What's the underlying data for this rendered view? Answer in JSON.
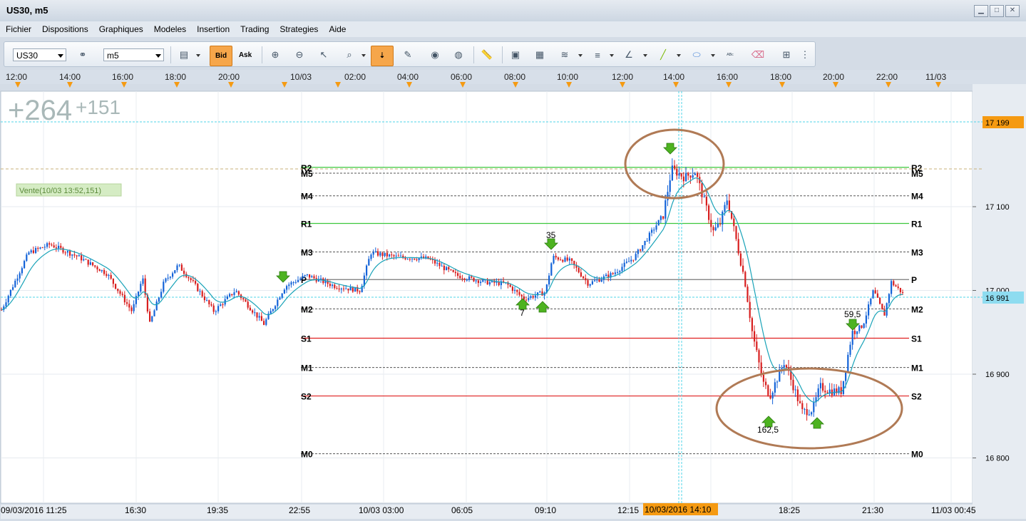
{
  "window": {
    "title": "US30, m5",
    "minimize": "▁",
    "maximize": "□",
    "close": "✕"
  },
  "menu": [
    "Fichier",
    "Dispositions",
    "Graphiques",
    "Modeles",
    "Insertion",
    "Trading",
    "Strategies",
    "Aide"
  ],
  "toolbar": {
    "symbol": "US30",
    "timeframe": "m5",
    "bid_label": "Bid",
    "ask_label": "Ask"
  },
  "top_axis": [
    "12:00",
    "14:00",
    "16:00",
    "18:00",
    "20:00",
    "10/03",
    "02:00",
    "04:00",
    "06:00",
    "08:00",
    "10:00",
    "12:00",
    "14:00",
    "16:00",
    "18:00",
    "20:00",
    "22:00",
    "11/03"
  ],
  "chart": {
    "pnl_total": "+264",
    "pnl_trade": "+151",
    "trade_label": "Vente(10/03 13:52,151)",
    "pivots": [
      {
        "label": "M5",
        "price": 17140,
        "style": "dash",
        "color": "#555"
      },
      {
        "label": "R2",
        "price": 17147,
        "style": "solid",
        "color": "#3cc83c"
      },
      {
        "label": "M4",
        "price": 17113,
        "style": "dash",
        "color": "#555"
      },
      {
        "label": "R1",
        "price": 17080,
        "style": "solid",
        "color": "#3cc83c"
      },
      {
        "label": "M3",
        "price": 17046,
        "style": "dash",
        "color": "#555"
      },
      {
        "label": "P",
        "price": 17013,
        "style": "solid",
        "color": "#777"
      },
      {
        "label": "M2",
        "price": 16978,
        "style": "dash",
        "color": "#555"
      },
      {
        "label": "S1",
        "price": 16943,
        "style": "solid",
        "color": "#e02020"
      },
      {
        "label": "M1",
        "price": 16908,
        "style": "dash",
        "color": "#555"
      },
      {
        "label": "S2",
        "price": 16874,
        "style": "solid",
        "color": "#e02020"
      },
      {
        "label": "M0",
        "price": 16805,
        "style": "dash",
        "color": "#555"
      }
    ],
    "price_axis": [
      "17 100",
      "17 000",
      "16 900",
      "16 800"
    ],
    "price_marker_high": "17 199",
    "price_marker_current": "16 991",
    "annotations": [
      "35",
      "7",
      "59,5",
      "162,5"
    ],
    "bottom_axis": [
      "09/03/2016 11:25",
      "16:30",
      "19:35",
      "22:55",
      "10/03 03:00",
      "06:05",
      "09:10",
      "12:15",
      "18:25",
      "21:30",
      "11/03 00:45"
    ],
    "cursor_time": "10/03/2016 14:10",
    "colors": {
      "bull": "#1463d8",
      "bear": "#d81f1f",
      "ma": "#19a3b8",
      "ellipse": "#b07a55",
      "highlight": "#f59a12",
      "crosshair": "#4fd4e8"
    }
  }
}
